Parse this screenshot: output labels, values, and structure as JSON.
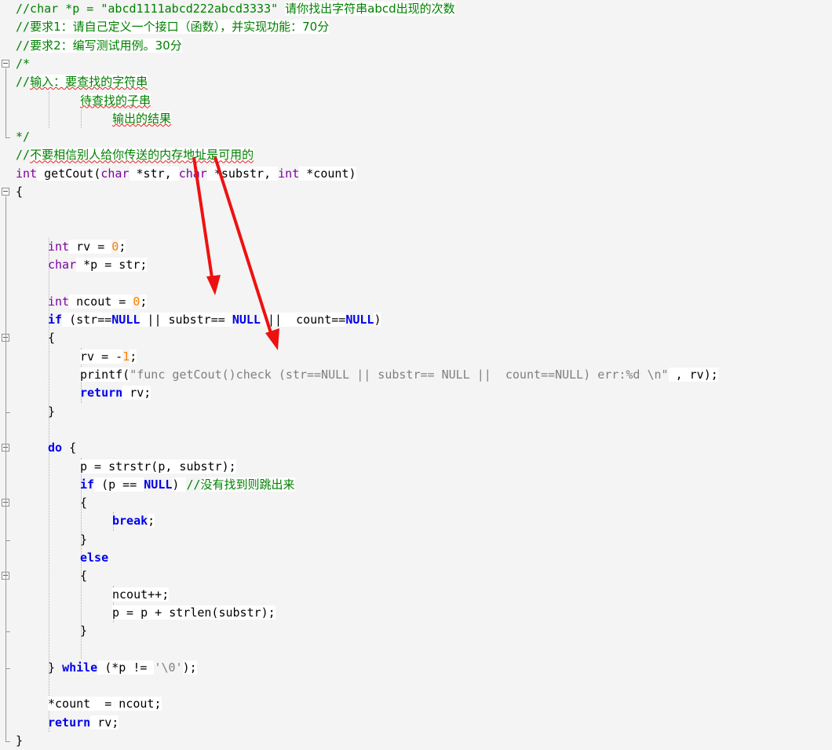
{
  "lines": [
    {
      "indent": 0,
      "tokens": [
        {
          "t": "//char *p = \"abcd1111abcd222abcd3333\" ",
          "c": "cmt"
        },
        {
          "t": "请你找出字符串abcd出现的次数",
          "c": "cmt-cn"
        }
      ]
    },
    {
      "indent": 0,
      "tokens": [
        {
          "t": "//",
          "c": "cmt"
        },
        {
          "t": "要求1：请自己定义一个接口（函数），并实现功能：70分",
          "c": "cmt-cn"
        }
      ]
    },
    {
      "indent": 0,
      "tokens": [
        {
          "t": "//",
          "c": "cmt"
        },
        {
          "t": "要求2：编写测试用例。30分",
          "c": "cmt-cn"
        }
      ]
    },
    {
      "indent": 0,
      "tokens": [
        {
          "t": "/*",
          "c": "cmt"
        }
      ]
    },
    {
      "indent": 0,
      "tokens": [
        {
          "t": "//",
          "c": "cmt"
        },
        {
          "t": "输入：要查找的字符串",
          "c": "cmt-cn squig"
        }
      ]
    },
    {
      "indent": 2,
      "tokens": [
        {
          "t": "待查找的子串",
          "c": "cmt-cn squig"
        }
      ]
    },
    {
      "indent": 3,
      "tokens": [
        {
          "t": "输出的结果",
          "c": "cmt-cn squig"
        }
      ]
    },
    {
      "indent": 0,
      "tokens": [
        {
          "t": "*/",
          "c": "cmt"
        }
      ]
    },
    {
      "indent": 0,
      "tokens": [
        {
          "t": "//",
          "c": "cmt"
        },
        {
          "t": "不要相信别人给你传送的内存地址是可用的",
          "c": "cmt-cn squig"
        }
      ]
    },
    {
      "indent": 0,
      "tokens": [
        {
          "t": "int",
          "c": "kw"
        },
        {
          "t": " getCout(",
          "c": "plain hl"
        },
        {
          "t": "char",
          "c": "kw"
        },
        {
          "t": " *str, ",
          "c": "plain hl"
        },
        {
          "t": "char",
          "c": "kw"
        },
        {
          "t": " *substr, ",
          "c": "plain hl"
        },
        {
          "t": "int",
          "c": "kw"
        },
        {
          "t": " *count)",
          "c": "plain hl"
        }
      ]
    },
    {
      "indent": 0,
      "tokens": [
        {
          "t": "{",
          "c": "plain"
        }
      ]
    },
    {
      "indent": 0,
      "tokens": []
    },
    {
      "indent": 0,
      "tokens": []
    },
    {
      "indent": 1,
      "tokens": [
        {
          "t": "int",
          "c": "kw"
        },
        {
          "t": " rv = ",
          "c": "plain hl"
        },
        {
          "t": "0",
          "c": "num"
        },
        {
          "t": ";",
          "c": "plain hl"
        }
      ]
    },
    {
      "indent": 1,
      "tokens": [
        {
          "t": "char",
          "c": "kw"
        },
        {
          "t": " *p = str;",
          "c": "plain hl"
        }
      ]
    },
    {
      "indent": 0,
      "tokens": []
    },
    {
      "indent": 1,
      "tokens": [
        {
          "t": "int",
          "c": "kw"
        },
        {
          "t": " ncout = ",
          "c": "plain hl"
        },
        {
          "t": "0",
          "c": "num"
        },
        {
          "t": ";",
          "c": "plain hl"
        }
      ]
    },
    {
      "indent": 1,
      "tokens": [
        {
          "t": "if",
          "c": "kw2"
        },
        {
          "t": " (str==",
          "c": "plain hl"
        },
        {
          "t": "NULL",
          "c": "kw2"
        },
        {
          "t": " || substr== ",
          "c": "plain hl"
        },
        {
          "t": "NULL",
          "c": "kw2"
        },
        {
          "t": " ||  count==",
          "c": "plain hl"
        },
        {
          "t": "NULL",
          "c": "kw2"
        },
        {
          "t": ")",
          "c": "plain hl"
        }
      ]
    },
    {
      "indent": 1,
      "tokens": [
        {
          "t": "{",
          "c": "plain"
        }
      ]
    },
    {
      "indent": 2,
      "tokens": [
        {
          "t": "rv = -",
          "c": "plain hl"
        },
        {
          "t": "1",
          "c": "num"
        },
        {
          "t": ";",
          "c": "plain hl"
        }
      ]
    },
    {
      "indent": 2,
      "tokens": [
        {
          "t": "printf(",
          "c": "plain hl"
        },
        {
          "t": "\"func getCout()check (str==NULL || substr== NULL ||  count==NULL) err:%d \\n\"",
          "c": "str"
        },
        {
          "t": " , rv);",
          "c": "plain hl"
        }
      ]
    },
    {
      "indent": 2,
      "tokens": [
        {
          "t": "return",
          "c": "kw2"
        },
        {
          "t": " rv;",
          "c": "plain hl"
        }
      ]
    },
    {
      "indent": 1,
      "tokens": [
        {
          "t": "}",
          "c": "plain"
        }
      ]
    },
    {
      "indent": 0,
      "tokens": []
    },
    {
      "indent": 1,
      "tokens": [
        {
          "t": "do",
          "c": "kw2"
        },
        {
          "t": " {",
          "c": "plain"
        }
      ]
    },
    {
      "indent": 2,
      "tokens": [
        {
          "t": "p = strstr(p, substr);",
          "c": "plain hl"
        }
      ]
    },
    {
      "indent": 2,
      "tokens": [
        {
          "t": "if",
          "c": "kw2"
        },
        {
          "t": " (p == ",
          "c": "plain hl"
        },
        {
          "t": "NULL",
          "c": "kw2"
        },
        {
          "t": ") ",
          "c": "plain hl"
        },
        {
          "t": "//",
          "c": "cmt"
        },
        {
          "t": "没有找到则跳出来",
          "c": "cmt-cn"
        }
      ]
    },
    {
      "indent": 2,
      "tokens": [
        {
          "t": "{",
          "c": "plain"
        }
      ]
    },
    {
      "indent": 3,
      "tokens": [
        {
          "t": "break",
          "c": "kw2"
        },
        {
          "t": ";",
          "c": "plain hl"
        }
      ]
    },
    {
      "indent": 2,
      "tokens": [
        {
          "t": "}",
          "c": "plain"
        }
      ]
    },
    {
      "indent": 2,
      "tokens": [
        {
          "t": "else",
          "c": "kw2"
        }
      ]
    },
    {
      "indent": 2,
      "tokens": [
        {
          "t": "{",
          "c": "plain"
        }
      ]
    },
    {
      "indent": 3,
      "tokens": [
        {
          "t": "ncout++;",
          "c": "plain hl"
        }
      ]
    },
    {
      "indent": 3,
      "tokens": [
        {
          "t": "p = p + strlen(substr);",
          "c": "plain hl"
        }
      ]
    },
    {
      "indent": 2,
      "tokens": [
        {
          "t": "}",
          "c": "plain"
        }
      ]
    },
    {
      "indent": 0,
      "tokens": []
    },
    {
      "indent": 1,
      "tokens": [
        {
          "t": "} ",
          "c": "plain"
        },
        {
          "t": "while",
          "c": "kw2"
        },
        {
          "t": " (*p != ",
          "c": "plain hl"
        },
        {
          "t": "'\\0'",
          "c": "str"
        },
        {
          "t": ");",
          "c": "plain hl"
        }
      ]
    },
    {
      "indent": 0,
      "tokens": []
    },
    {
      "indent": 1,
      "tokens": [
        {
          "t": "*count  = ncout;",
          "c": "plain hl"
        }
      ]
    },
    {
      "indent": 1,
      "tokens": [
        {
          "t": "return",
          "c": "kw2"
        },
        {
          "t": " rv;",
          "c": "plain hl"
        }
      ]
    },
    {
      "indent": 0,
      "tokens": [
        {
          "t": "}",
          "c": "plain"
        }
      ]
    }
  ],
  "colors": {
    "keyword_type": "#7f00a0",
    "keyword_flow": "#0000ee",
    "number": "#ff8000",
    "comment": "#008000",
    "string": "#7f7f7f",
    "annotation_arrow": "#ee1111"
  },
  "icons": {
    "fold_marker": "minus-box-icon",
    "annotation": "red-arrow-icon"
  }
}
